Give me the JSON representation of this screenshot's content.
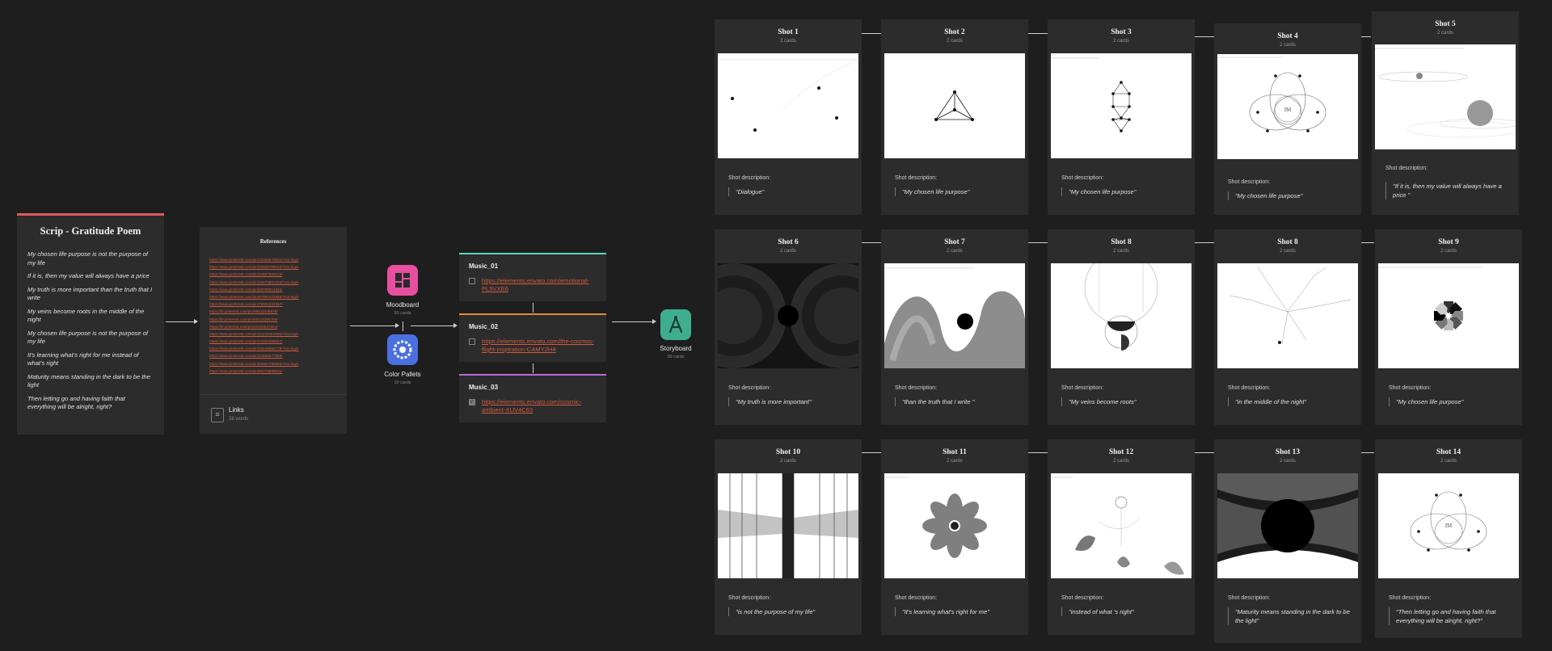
{
  "script_card": {
    "title": "Scrip - Gratitude Poem",
    "lines": [
      "My chosen life purpose is not the purpose of my life",
      "If it is, then my value will always have a price",
      "My truth is more important than the truth that I write",
      "My veins become roots in the middle of the night",
      "My chosen life purpose is not the purpose of my life",
      "It's learning what's right for me instead of what's right",
      "Maturity means standing in the dark to be the light",
      "Then letting go and having faith that everything will be alright, right?"
    ],
    "accent": "#e05a5a"
  },
  "references": {
    "title": "References",
    "urls": [
      "https://www.pinterest.com/pin/12345678901/?mt=login",
      "https://www.pinterest.com/pin/23456789012/?mt=login",
      "https://www.pinterest.com/pin/34567890123/",
      "https://www.pinterest.com/pin/45678901234/?mt=login",
      "https://www.pinterest.com/pin/56789012345/",
      "https://www.pinterest.com/pin/67890123456/?mt=login",
      "https://www.pinterest.com/pin/78901234567/",
      "https://br.pinterest.com/pin/89012345678/",
      "https://br.pinterest.com/pin/90123456789/",
      "https://br.pinterest.com/pin/10293847561/",
      "https://www.pinterest.com/pin/11223344556/?mt=login",
      "https://www.pinterest.com/pin/22334455667/",
      "https://www.pinterest.com/pin/33445566778/?mt=login",
      "https://www.pinterest.com/pin/44556677889/",
      "https://www.pinterest.com/pin/55667788990/?mt=login",
      "https://www.pinterest.com/pin/66778899001/"
    ],
    "footer_label": "Links",
    "footer_sub": "28 words"
  },
  "apps": {
    "moodboard": {
      "label": "Moodboard",
      "sub": "50 cards",
      "color": "#e84fa0"
    },
    "color_pallets": {
      "label": "Color Pallets",
      "sub": "10 cards",
      "color": "#4a6fe0"
    },
    "storyboard": {
      "label": "Storyboard",
      "sub": "30 cards",
      "color": "#3fae8e"
    }
  },
  "music": [
    {
      "title": "Music_01",
      "link": "https://elements.envato.com/emotional-PL5VXE6",
      "checked": false,
      "accent": "#5fd3c2"
    },
    {
      "title": "Music_02",
      "link": "https://elements.envato.com/the-cosmos-flight-inspiration-CAMY2H4",
      "checked": false,
      "accent": "#e08a3a"
    },
    {
      "title": "Music_03",
      "link": "https://elements.envato.com/cosmic-ambient-XUV4C63",
      "checked": true,
      "accent": "#b66ad8"
    }
  ],
  "shot_desc_label": "Shot description:",
  "shots": [
    {
      "title": "Shot 1",
      "count": "2 cards",
      "quote": "\"Dialogue\""
    },
    {
      "title": "Shot 2",
      "count": "2 cards",
      "quote": "\"My chosen life purpose\""
    },
    {
      "title": "Shot 3",
      "count": "2 cards",
      "quote": "\"My chosen life purpose\""
    },
    {
      "title": "Shot 4",
      "count": "2 cards",
      "quote": "\"My chosen life purpose\""
    },
    {
      "title": "Shot 5",
      "count": "2 cards",
      "quote": "\"If it is, then my value will always have a price \""
    },
    {
      "title": "Shot 6",
      "count": "2 cards",
      "quote": "\"My truth is more important\""
    },
    {
      "title": "Shot 7",
      "count": "2 cards",
      "quote": "\"than the truth that I write \""
    },
    {
      "title": "Shot 8",
      "count": "2 cards",
      "quote": "\"My veins become roots\""
    },
    {
      "title": "Shot 8",
      "count": "2 cards",
      "quote": "\"in the middle of the night\""
    },
    {
      "title": "Shot 9",
      "count": "2 cards",
      "quote": "\"My chosen life purpose\""
    },
    {
      "title": "Shot 10",
      "count": "2 cards",
      "quote": "\"is not the purpose of my life\""
    },
    {
      "title": "Shot 11",
      "count": "2 cards",
      "quote": "\"It's learning what's right for me\""
    },
    {
      "title": "Shot 12",
      "count": "2 cards",
      "quote": "\"instead of what 's right\""
    },
    {
      "title": "Shot 13",
      "count": "2 cards",
      "quote": "\"Maturity means standing in the dark to be the light\""
    },
    {
      "title": "Shot 14",
      "count": "2 cards",
      "quote": "\"Then letting go and having faith that everything will be alright, right?\""
    }
  ]
}
